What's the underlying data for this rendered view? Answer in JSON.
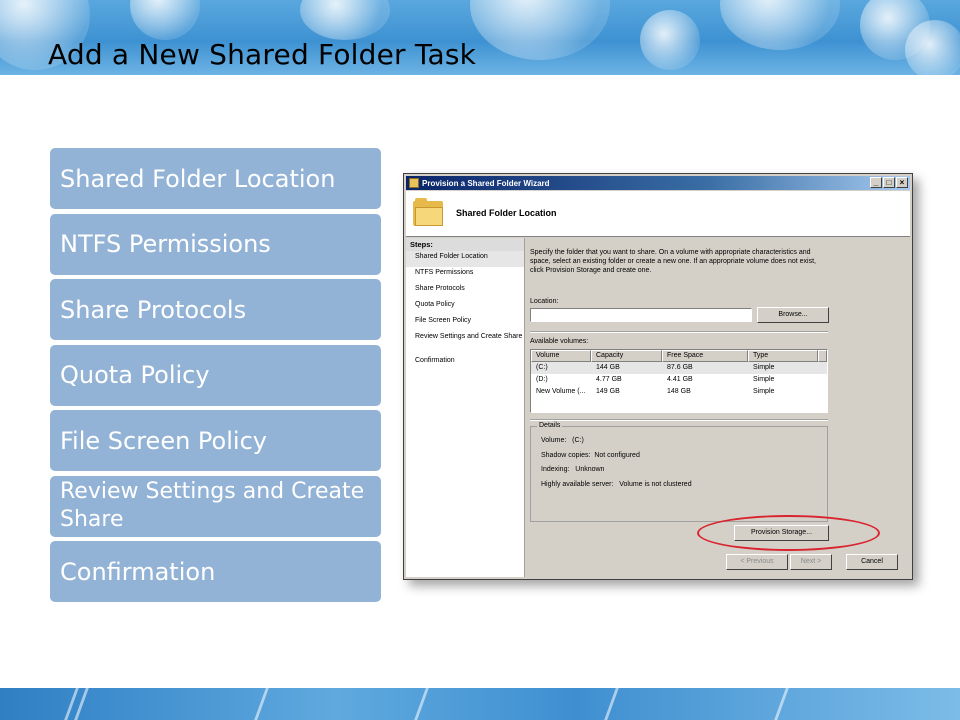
{
  "slide": {
    "title": "Add a New Shared Folder Task",
    "accent_color": "#93b3d6",
    "steps": [
      "Shared Folder Location",
      "NTFS Permissions",
      "Share Protocols",
      "Quota Policy",
      "File Screen Policy",
      "Review Settings and Create Share",
      "Confirmation"
    ]
  },
  "wizard": {
    "title": "Provision a Shared Folder Wizard",
    "banner_title": "Shared Folder Location",
    "icon": "folder-icon",
    "steps_header": "Steps:",
    "steps": [
      "Shared Folder Location",
      "NTFS Permissions",
      "Share Protocols",
      "Quota Policy",
      "File Screen Policy",
      "Review Settings and Create Share",
      "Confirmation"
    ],
    "intro": "Specify the folder that you want to share. On a volume with appropriate characteristics and space, select an existing folder or create a new one. If an appropriate volume does not exist, click Provision Storage and create one.",
    "location_label": "Location:",
    "location_value": "",
    "browse_label": "Browse...",
    "available_label": "Available volumes:",
    "columns": [
      "Volume",
      "Capacity",
      "Free Space",
      "Type"
    ],
    "rows": [
      [
        "(C:)",
        "144 GB",
        "87.6 GB",
        "Simple"
      ],
      [
        "(D:)",
        "4.77 GB",
        "4.41 GB",
        "Simple"
      ],
      [
        "New Volume (...",
        "149 GB",
        "148 GB",
        "Simple"
      ]
    ],
    "details": {
      "legend": "Details",
      "volume_label": "Volume:",
      "volume_value": "(C:)",
      "shadow_label": "Shadow copies:",
      "shadow_value": "Not configured",
      "indexing_label": "Indexing:",
      "indexing_value": "Unknown",
      "ha_label": "Highly available server:",
      "ha_value": "Volume is not clustered"
    },
    "provision_label": "Provision Storage...",
    "previous_label": "< Previous",
    "next_label": "Next >",
    "cancel_label": "Cancel",
    "titlebar_buttons": [
      "_",
      "□",
      "×"
    ]
  }
}
